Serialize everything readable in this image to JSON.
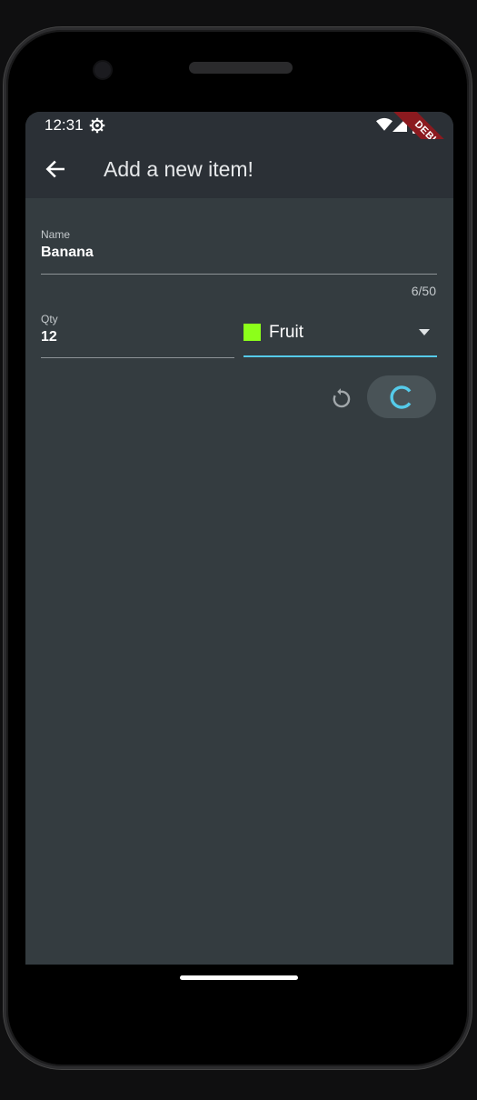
{
  "status_bar": {
    "time": "12:31",
    "debug_label": "DEBUG"
  },
  "app_bar": {
    "title": "Add a new item!"
  },
  "form": {
    "name": {
      "label": "Name",
      "value": "Banana",
      "counter": "6/50"
    },
    "qty": {
      "label": "Qty",
      "value": "12"
    },
    "category": {
      "selected": "Fruit",
      "swatch_color": "#8cff1a"
    },
    "accent_color": "#55cbea"
  },
  "icons": {
    "back": "arrow-left-icon",
    "settings": "gear-icon",
    "reset": "refresh-icon",
    "submit": "progress-spinner-icon"
  }
}
